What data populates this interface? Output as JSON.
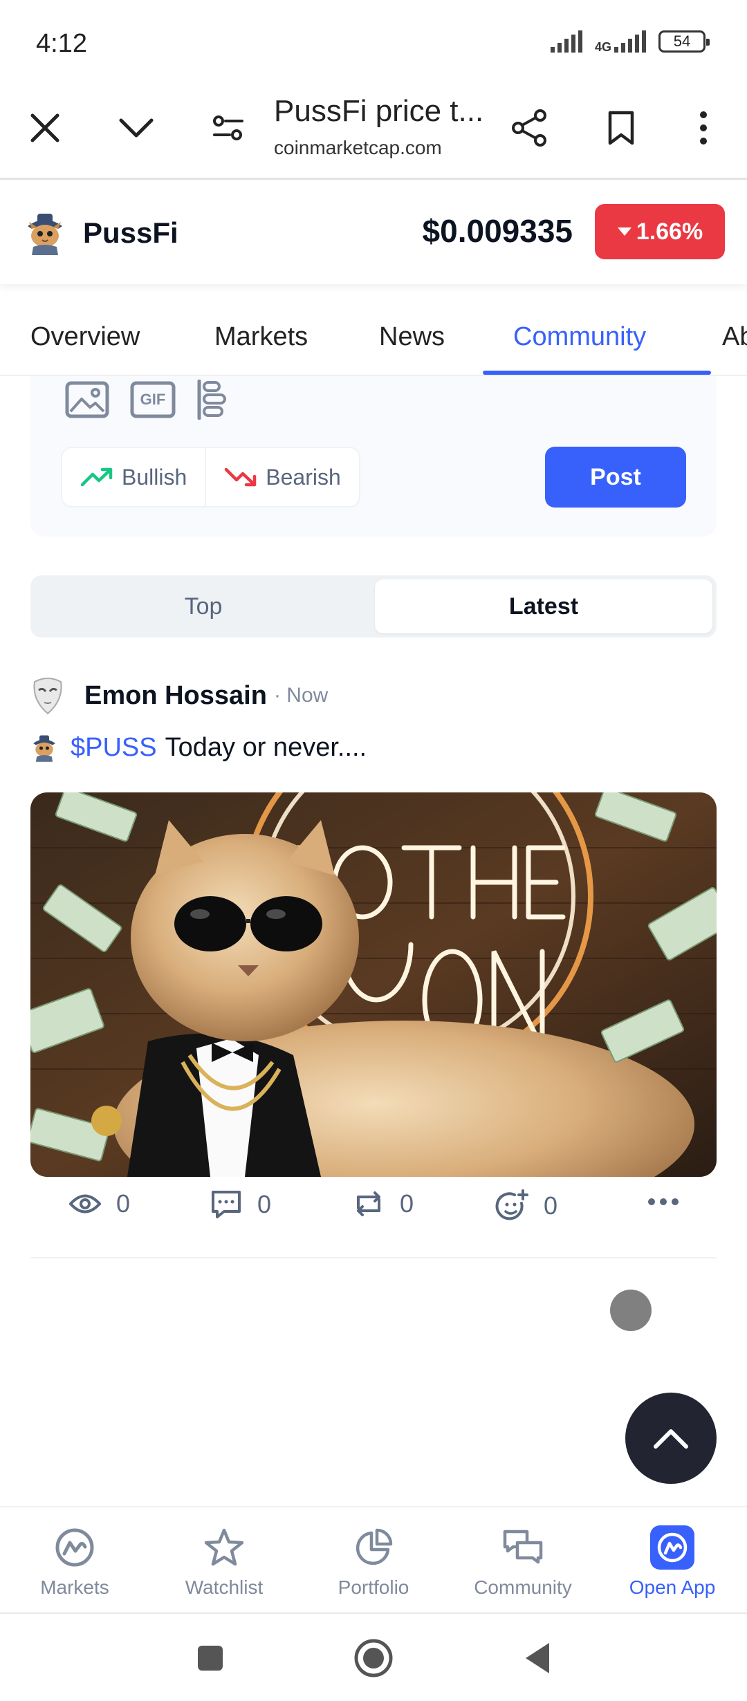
{
  "status_bar": {
    "time": "4:12",
    "network": "4G",
    "battery": "54"
  },
  "browser": {
    "page_title": "PussFi price t...",
    "url": "coinmarketcap.com"
  },
  "coin": {
    "name": "PussFi",
    "price": "$0.009335",
    "change": "1.66%",
    "change_color": "#ea3943"
  },
  "tabs": [
    {
      "label": "Overview"
    },
    {
      "label": "Markets"
    },
    {
      "label": "News"
    },
    {
      "label": "Community"
    },
    {
      "label": "Ab"
    }
  ],
  "composer": {
    "bullish_label": "Bullish",
    "bearish_label": "Bearish",
    "post_label": "Post",
    "gif_label": "GIF"
  },
  "feed_toggle": {
    "top_label": "Top",
    "latest_label": "Latest",
    "selected": "Latest"
  },
  "post": {
    "author": "Emon Hossain",
    "time": "· Now",
    "cashtag": "$PUSS",
    "text": "Today or never....",
    "views": "0",
    "comments": "0",
    "reposts": "0",
    "reactions": "0"
  },
  "app_nav": [
    {
      "label": "Markets",
      "icon": "markets-icon"
    },
    {
      "label": "Watchlist",
      "icon": "star-icon"
    },
    {
      "label": "Portfolio",
      "icon": "pie-chart-icon"
    },
    {
      "label": "Community",
      "icon": "chat-bubbles-icon"
    },
    {
      "label": "Open App",
      "icon": "cmc-app-icon"
    }
  ],
  "colors": {
    "accent": "#3861fb",
    "negative": "#ea3943",
    "positive": "#16c784"
  }
}
